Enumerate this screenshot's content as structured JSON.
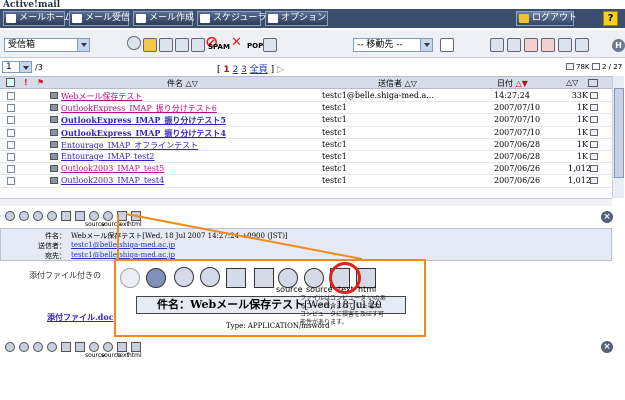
{
  "app": {
    "logo": "Active!mail"
  },
  "nav": {
    "home": "メールホーム",
    "inbox": "メール受信",
    "compose": "メール作成",
    "schedule": "スケジューラ",
    "options": "オプション",
    "logout": "ログアウト",
    "help": "?"
  },
  "toolbar": {
    "folder": "受信箱",
    "spam": "SPAM",
    "pop": "POP",
    "move_to": "-- 移動先 --",
    "help_badge": "H"
  },
  "list": {
    "page_select": "1",
    "page_total": "/3",
    "pager_prefix": "[",
    "pages": [
      "1",
      "2",
      "3"
    ],
    "all_pages": "全頁",
    "pager_suffix": "]",
    "quota": "78K",
    "count": "2 / 27",
    "columns": {
      "subject": "件名",
      "sender": "送信者",
      "date": "日付"
    },
    "rows": [
      {
        "subject": "Webメール保存テスト",
        "from": "testc1@belle.shiga-med.a...",
        "date": "14:27:24",
        "size": "33K",
        "style": "pink"
      },
      {
        "subject": "OutlookExpress_IMAP_振り分けテスト6",
        "from": "testc1",
        "date": "2007/07/10",
        "size": "1K",
        "style": "pink"
      },
      {
        "subject": "OutlookExpress_IMAP_振り分けテスト5",
        "from": "testc1",
        "date": "2007/07/10",
        "size": "1K",
        "style": "bold"
      },
      {
        "subject": "OutlookExpress_IMAP_振り分けテスト4",
        "from": "testc1",
        "date": "2007/07/10",
        "size": "1K",
        "style": "bold"
      },
      {
        "subject": "Entourage_IMAP_オフラインテスト",
        "from": "testc1",
        "date": "2007/06/28",
        "size": "1K",
        "style": "normal"
      },
      {
        "subject": "Entourage_IMAP_test2",
        "from": "testc1",
        "date": "2007/06/28",
        "size": "1K",
        "style": "normal"
      },
      {
        "subject": "Outlook2003_IMAP_test5",
        "from": "testc1",
        "date": "2007/06/26",
        "size": "1,012",
        "style": "pink"
      },
      {
        "subject": "Outlook2003_IMAP_test4",
        "from": "testc1",
        "date": "2007/06/26",
        "size": "1,012",
        "style": "normal"
      }
    ]
  },
  "preview": {
    "labels": {
      "source1": "source",
      "source2": "source",
      "text": "text",
      "html": "html"
    },
    "close": "×",
    "header": {
      "subject_label": "件名：",
      "subject_value": "Webメール保存テスト[Wed, 18 Jul 2007 14:27:24 +0900 (JST)]",
      "from_label": "送信者：",
      "from_value": "testc1@belle.shiga-med.ac.jp",
      "to_label": "宛先：",
      "to_value": "testc1@belle.shiga-med.ac.jp"
    },
    "attach_label": "添付ファイル付きの",
    "attach_link": "添付ファイル.doc"
  },
  "zoom": {
    "source1": "source",
    "source2": "source",
    "text": "text",
    "html": "html",
    "title_label": "件名：",
    "title_value": "Webメール保存テスト",
    "title_date": "[Wed, 18 Jul 20",
    "type": "Type: APPLICATION/msword",
    "note": "ファイルはコンピュータ いのあるコードが含まれて いた場合、コンピュータに損害を及ぼす可 能性があります。"
  },
  "colors": {
    "nav_bg": "#3c4e6e",
    "callout": "#f08a1c",
    "highlight": "#e0201c",
    "link": "#3a20c0"
  }
}
